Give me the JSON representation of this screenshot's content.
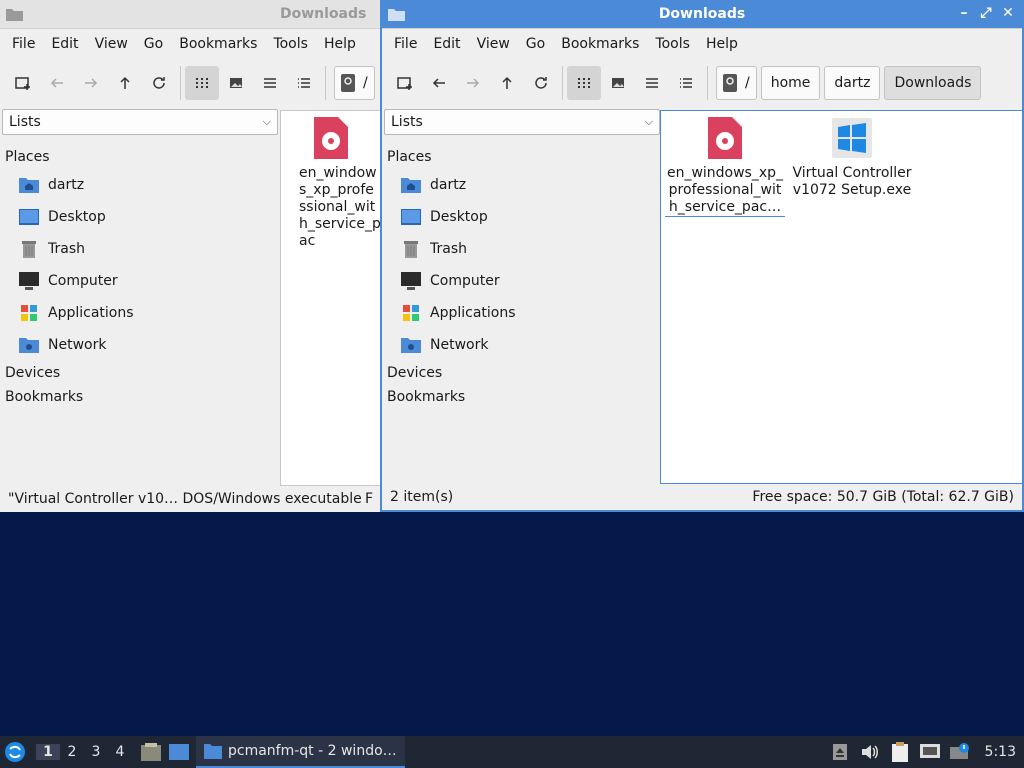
{
  "back_window": {
    "title": "Downloads",
    "menu": [
      "File",
      "Edit",
      "View",
      "Go",
      "Bookmarks",
      "Tools",
      "Help"
    ],
    "path_root": "/",
    "combo": "Lists",
    "file_name": "en_windows_xp_professional_with_service_pac",
    "status_left": "\"Virtual Controller v10… DOS/Windows executable",
    "status_right": "F"
  },
  "front_window": {
    "title": "Downloads",
    "menu": [
      "File",
      "Edit",
      "View",
      "Go",
      "Bookmarks",
      "Tools",
      "Help"
    ],
    "path": [
      "/",
      "home",
      "dartz",
      "Downloads"
    ],
    "combo": "Lists",
    "files": [
      {
        "name": "en_windows_xp_professional_with_service_pac…",
        "icon": "disc-image-icon"
      },
      {
        "name": "Virtual Controller v1072 Setup.exe",
        "icon": "windows-exe-icon"
      }
    ],
    "status_left": "2 item(s)",
    "status_right": "Free space: 50.7 GiB (Total: 62.7 GiB)"
  },
  "sidebar": {
    "places_header": "Places",
    "items": [
      {
        "label": "dartz",
        "icon": "home-folder-icon"
      },
      {
        "label": "Desktop",
        "icon": "desktop-icon"
      },
      {
        "label": "Trash",
        "icon": "trash-icon"
      },
      {
        "label": "Computer",
        "icon": "computer-icon"
      },
      {
        "label": "Applications",
        "icon": "applications-icon"
      },
      {
        "label": "Network",
        "icon": "network-icon"
      }
    ],
    "devices_header": "Devices",
    "bookmarks_header": "Bookmarks"
  },
  "taskbar": {
    "desktops": [
      "1",
      "2",
      "3",
      "4"
    ],
    "task_label": "pcmanfm-qt - 2 windo…",
    "clock": "5:13"
  },
  "colors": {
    "accent": "#4a8ad6",
    "taskbar": "#1f2734",
    "disc_icon": "#d9415f",
    "windows_icon": "#1e88e5"
  }
}
